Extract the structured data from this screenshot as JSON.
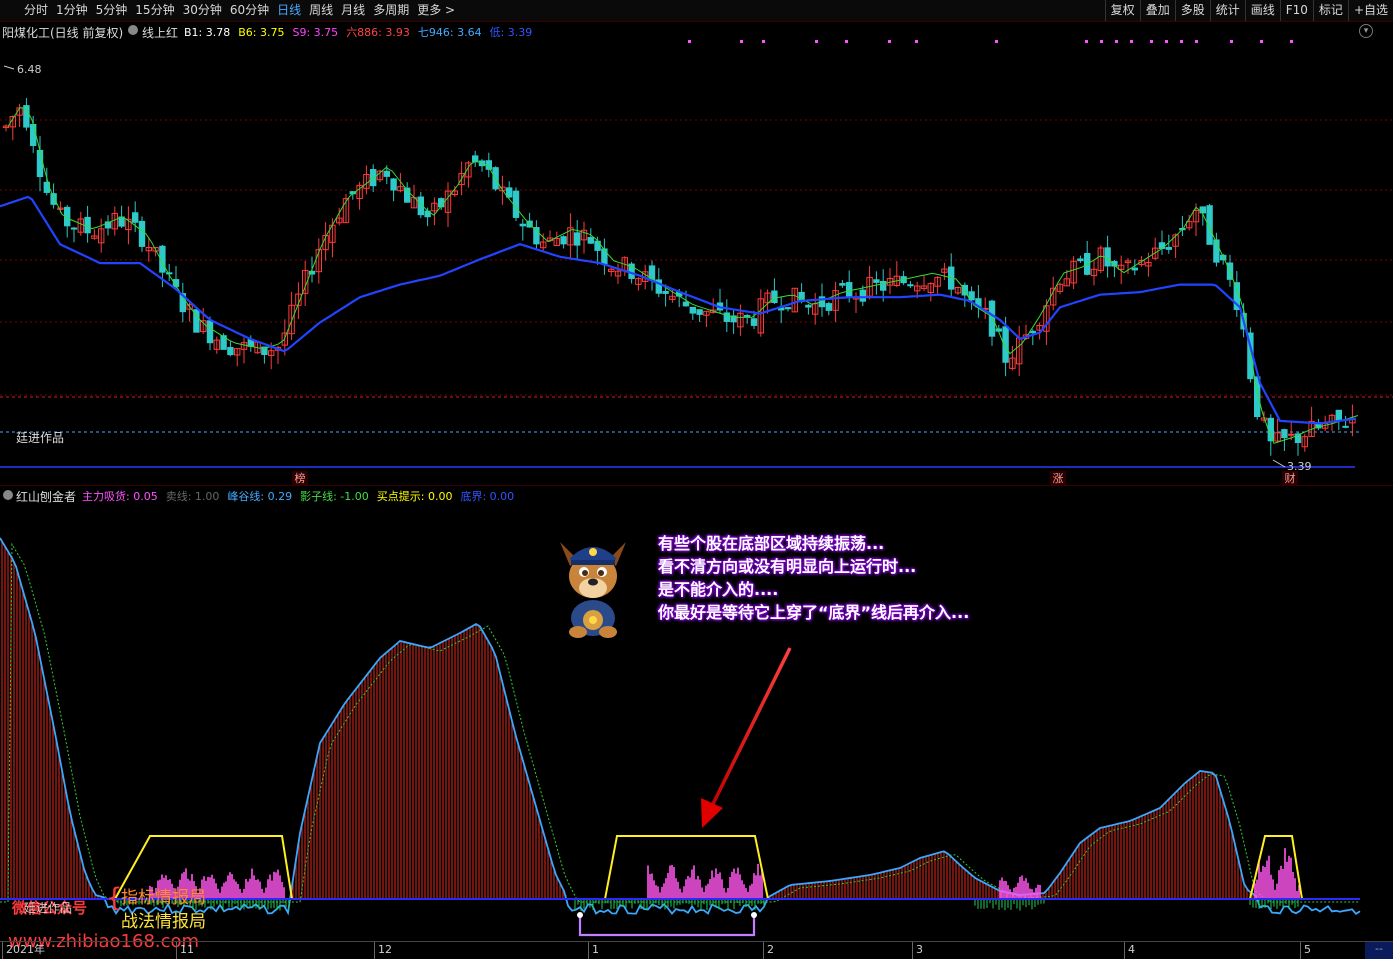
{
  "toolbar": {
    "periods": [
      "分时",
      "1分钟",
      "5分钟",
      "15分钟",
      "30分钟",
      "60分钟",
      "日线",
      "周线",
      "月线",
      "多周期",
      "更多 >"
    ],
    "active_period": "日线",
    "right_buttons": [
      "复权",
      "叠加",
      "多股",
      "统计",
      "画线",
      "F10",
      "标记",
      "+自选"
    ]
  },
  "main_panel": {
    "stock_title": "阳煤化工(日线 前复权)",
    "indicator_name": "线上红",
    "legend": [
      {
        "label": "B1: 3.78",
        "color": "#ffffff"
      },
      {
        "label": "B6: 3.75",
        "color": "#ffff00"
      },
      {
        "label": "S9: 3.75",
        "color": "#ff44ff"
      },
      {
        "label": "六886: 3.93",
        "color": "#ff4444"
      },
      {
        "label": "七946: 3.64",
        "color": "#44aaff"
      },
      {
        "label": "低: 3.39",
        "color": "#3355ff"
      }
    ],
    "high_label": "6.48",
    "low_label": "3.39",
    "watermark": "廷进作品",
    "markers": [
      {
        "text": "榜",
        "x_label": "12月"
      },
      {
        "text": "涨",
        "x_label": "4月"
      },
      {
        "text": "财",
        "x_label": "5月"
      }
    ]
  },
  "sub_panel": {
    "indicator_name": "红山刨金者",
    "legend": [
      {
        "label": "主力吸货: 0.05",
        "color": "#ff55ff"
      },
      {
        "label": "卖线: 1.00",
        "color": "#666666"
      },
      {
        "label": "峰谷线: 0.29",
        "color": "#44aaff"
      },
      {
        "label": "影子线: -1.00",
        "color": "#44dd44"
      },
      {
        "label": "买点提示: 0.00",
        "color": "#ffff00"
      },
      {
        "label": "底界: 0.00",
        "color": "#3355ff"
      }
    ],
    "annotation_lines": [
      "有些个股在底部区域持续振荡...",
      "看不清方向或没有明显向上运行时...",
      "是不能介入的....",
      "你最好是等待它上穿了“底界”线后再介入..."
    ],
    "promo": {
      "left": "微信公众号",
      "left_overlap": "廷进作品",
      "tag1": "指标情报局",
      "tag2": "战法情报局",
      "url": "www.zhibiao168.com"
    }
  },
  "x_axis": {
    "labels": [
      "2021年",
      "11",
      "12",
      "1",
      "2",
      "3",
      "4",
      "5"
    ]
  },
  "chart_data": {
    "type": "candlestick",
    "title": "阳煤化工(日线 前复权)",
    "y_range": [
      3.39,
      6.48
    ],
    "colors": {
      "up": "#ff3b3b",
      "down": "#2ec9c9",
      "ma_short": "#33dd33",
      "ma_long": "#2244ff"
    },
    "x_ticks": [
      "11",
      "12",
      "1",
      "2",
      "3",
      "4",
      "5"
    ],
    "series_close_shape": "descending from 6.48 to ~4.7, rally to ~5.9, decline to ~4.5, flat ~4.8, spike to ~5.5, drop to 3.39, slight recovery to ~3.7"
  }
}
